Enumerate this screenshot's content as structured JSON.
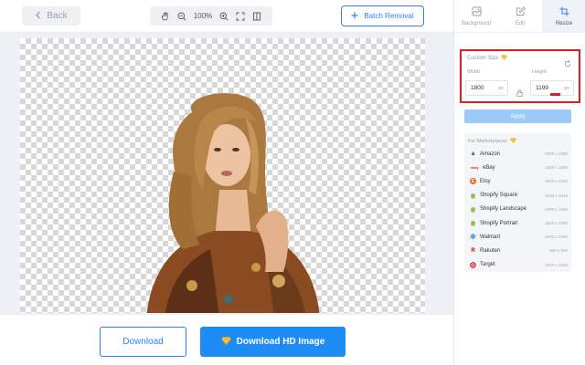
{
  "toolbar": {
    "back_label": "Back",
    "zoom_level": "100%",
    "batch_label": "Batch Removal"
  },
  "right_tabs": [
    {
      "label": "Background",
      "icon": "background-icon"
    },
    {
      "label": "Edit",
      "icon": "edit-icon"
    },
    {
      "label": "Resize",
      "icon": "crop-icon",
      "active": true
    }
  ],
  "custom_size": {
    "title": "Custom Size",
    "width_label": "Width",
    "height_label": "Height",
    "width_value": "1800",
    "height_value": "1199",
    "unit": "px"
  },
  "apply_label": "Apply",
  "marketplaces": {
    "title": "For Marketplaces",
    "items": [
      {
        "name": "Amazon",
        "size": "2000 x 2000",
        "icon": "amazon-icon"
      },
      {
        "name": "eBay",
        "size": "1600 x 1600",
        "icon": "ebay-icon"
      },
      {
        "name": "Etsy",
        "size": "2000 x 2000",
        "icon": "etsy-icon"
      },
      {
        "name": "Shopify Square",
        "size": "2048 x 2048",
        "icon": "shopify-icon"
      },
      {
        "name": "Shopify Landscape",
        "size": "2000 x 1800",
        "icon": "shopify-icon"
      },
      {
        "name": "Shopify Portrait",
        "size": "1600 x 2000",
        "icon": "shopify-icon"
      },
      {
        "name": "Walmart",
        "size": "2000 x 2000",
        "icon": "walmart-icon"
      },
      {
        "name": "Rakuten",
        "size": "800 x 800",
        "icon": "rakuten-icon"
      },
      {
        "name": "Target",
        "size": "2000 x 2000",
        "icon": "target-icon"
      }
    ]
  },
  "download": {
    "download_label": "Download",
    "hd_label": "Download HD Image"
  },
  "colors": {
    "accent": "#2d7ff9",
    "highlight_box": "#e21b1b",
    "premium_gem": "#f5a623"
  }
}
